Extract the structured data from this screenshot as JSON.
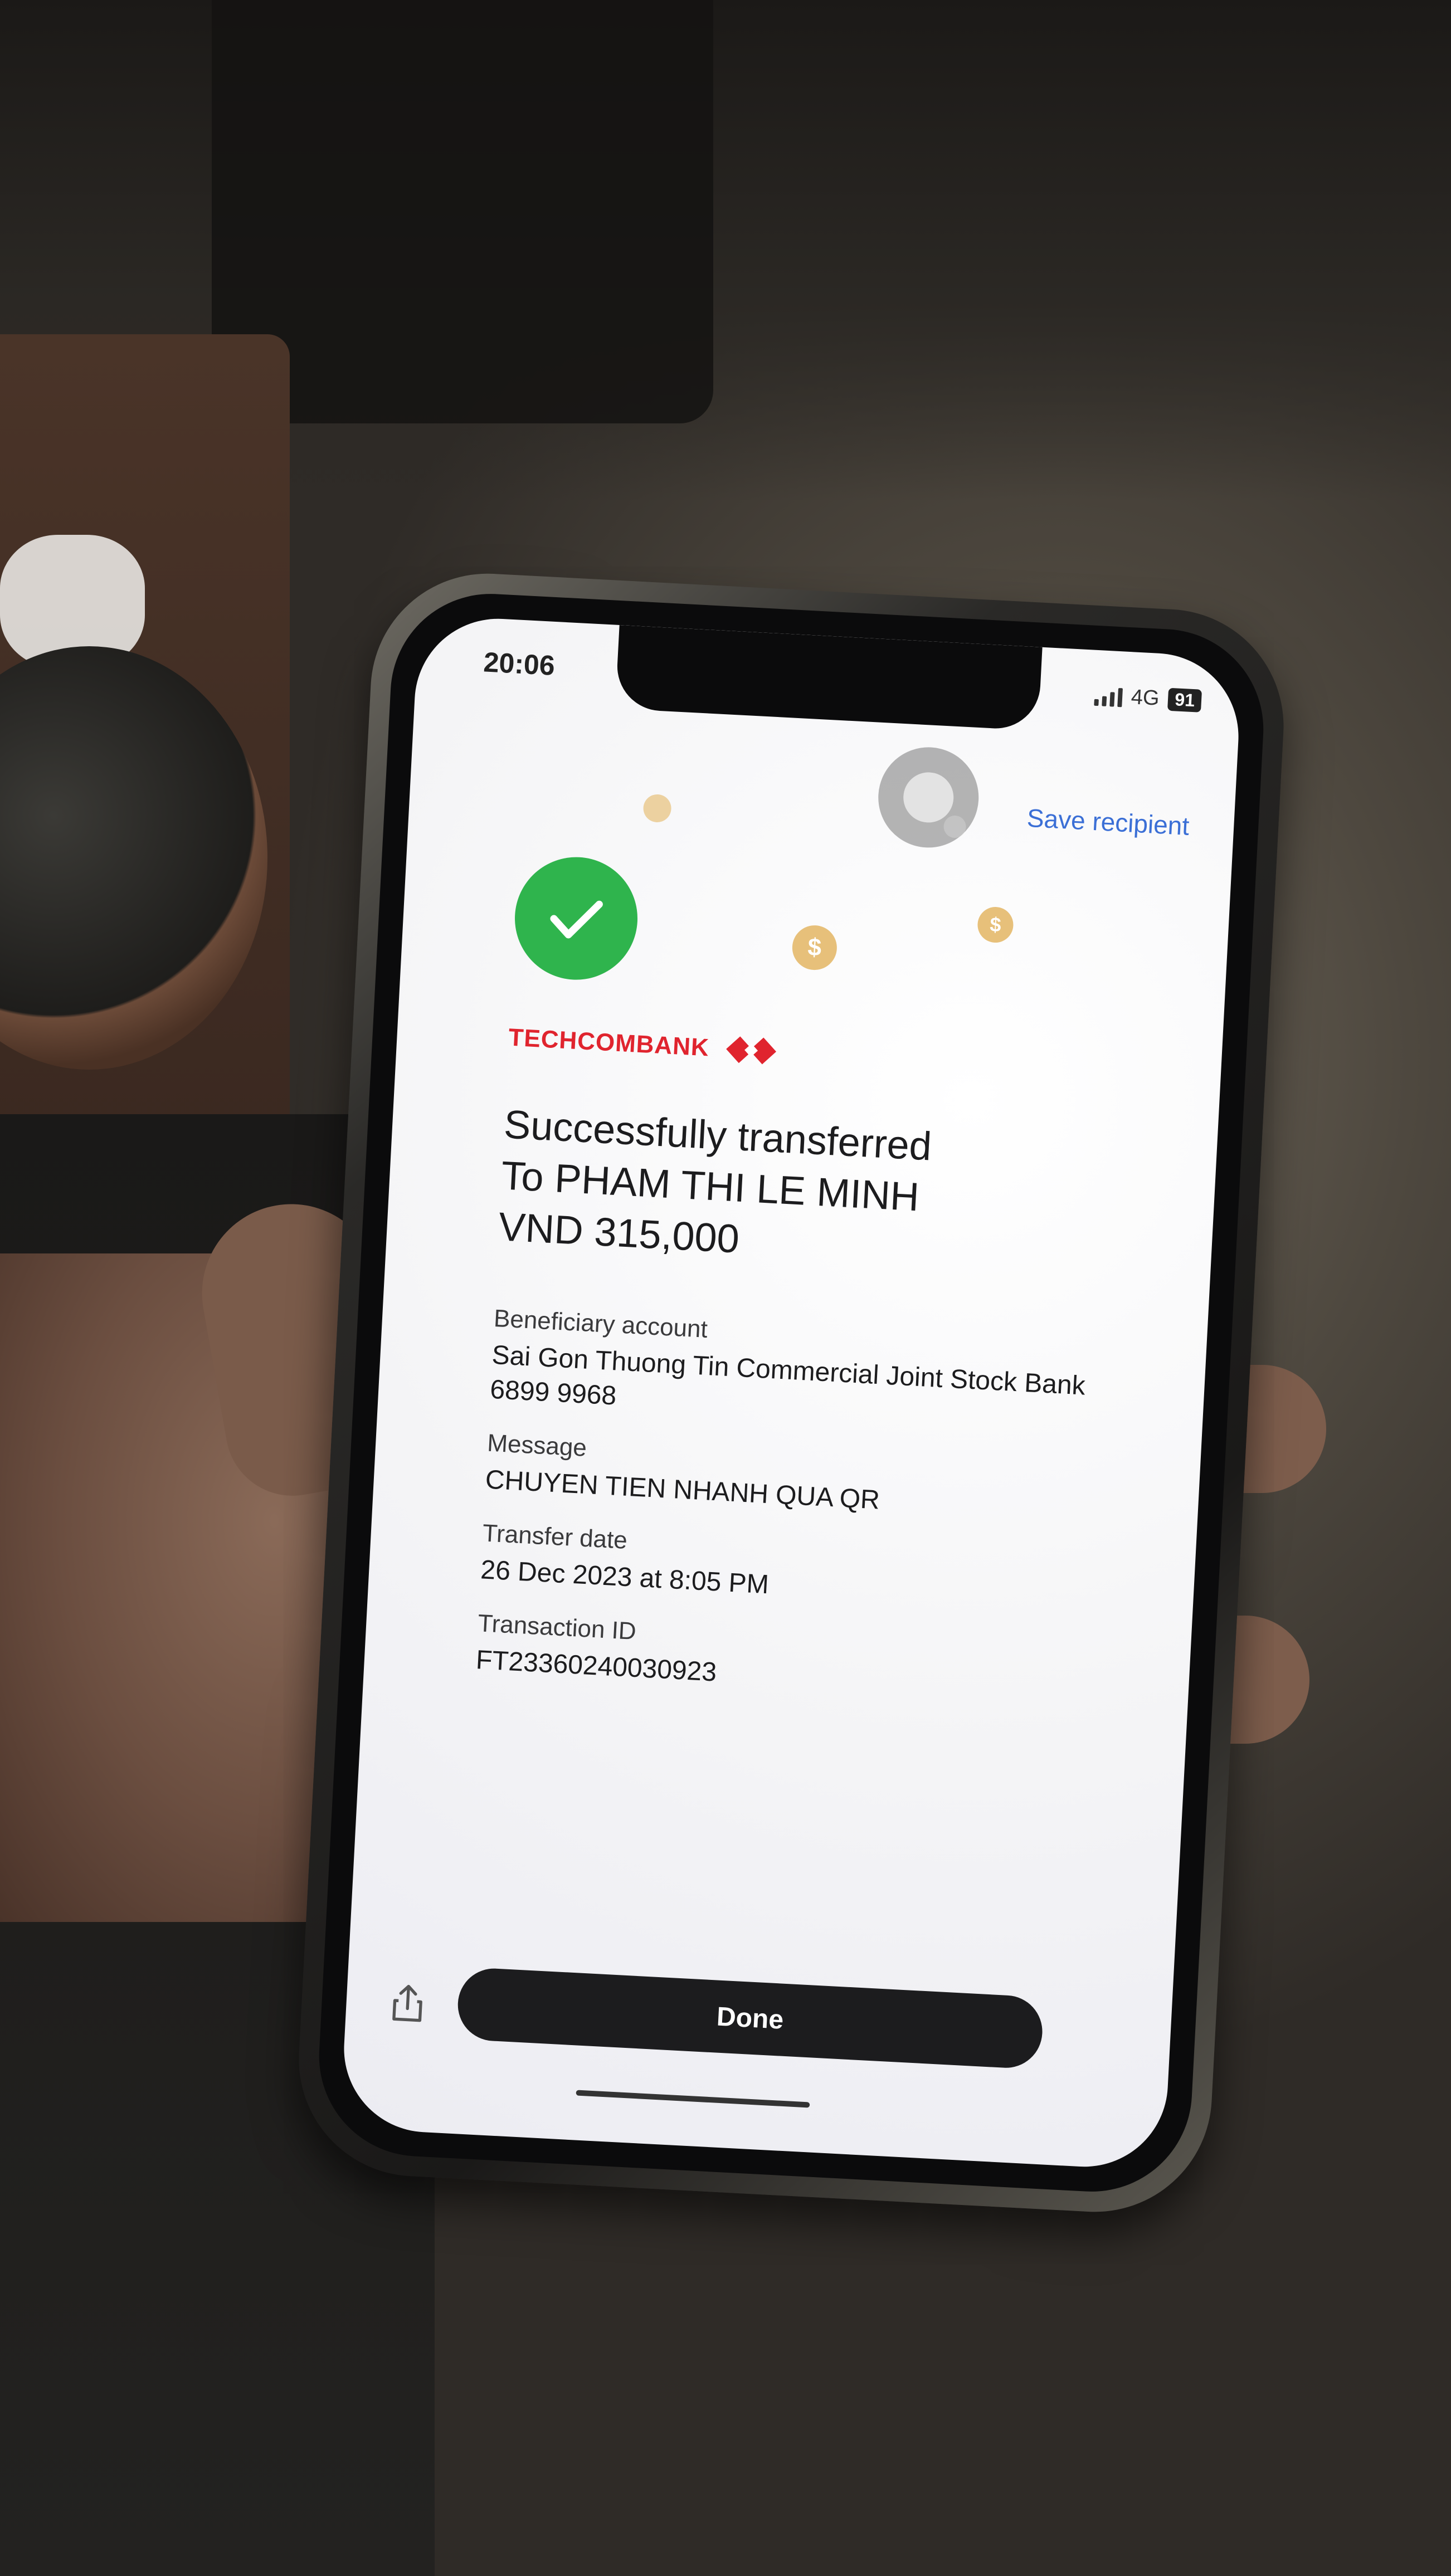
{
  "status_bar": {
    "time": "20:06",
    "network": "4G",
    "battery": "91"
  },
  "header": {
    "save_recipient_label": "Save recipient"
  },
  "brand": {
    "name": "TECHCOMBANK",
    "color": "#e0242e"
  },
  "headline": {
    "line1": "Successfully transferred",
    "line2": "To PHAM THI LE MINH",
    "line3": "VND 315,000"
  },
  "details": {
    "beneficiary_label": "Beneficiary account",
    "beneficiary_bank": "Sai Gon Thuong Tin Commercial Joint Stock Bank",
    "beneficiary_number": "6899 9968",
    "message_label": "Message",
    "message_value": "CHUYEN TIEN NHANH QUA QR",
    "date_label": "Transfer date",
    "date_value": "26 Dec 2023 at 8:05 PM",
    "txn_label": "Transaction ID",
    "txn_value": "FT23360240030923"
  },
  "footer": {
    "done_label": "Done"
  },
  "icons": {
    "success": "check-circle-icon",
    "share": "share-icon",
    "coin": "dollar-coin-icon"
  },
  "colors": {
    "success_green": "#2fb44d",
    "link_blue": "#3b6fd6",
    "button_dark": "#1c1c1e"
  }
}
